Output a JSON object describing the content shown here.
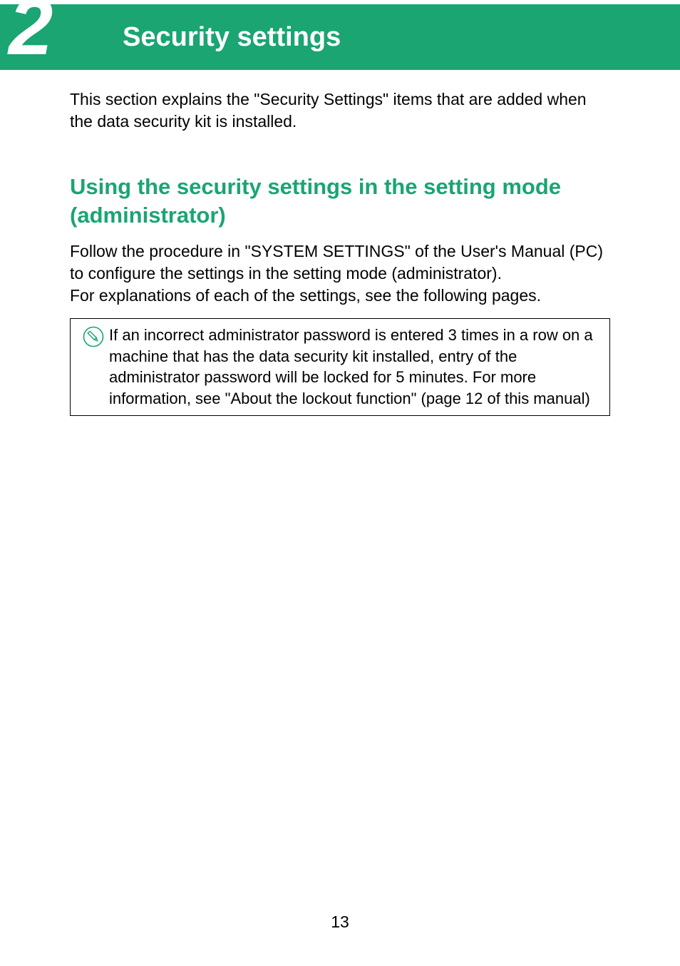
{
  "header": {
    "chapter_number": "2",
    "chapter_title": "Security settings"
  },
  "intro": "This section explains the \"Security Settings\" items that are added when the data security kit is installed.",
  "section": {
    "heading": "Using the security settings in the setting mode (administrator)",
    "body": "Follow the procedure in \"SYSTEM SETTINGS\" of the User's Manual (PC) to configure the settings in the setting mode (administrator).\nFor explanations of each of the settings, see the following pages."
  },
  "note": {
    "icon_name": "pencil-circle-icon",
    "text": "If an incorrect administrator password is entered 3 times in a row on a machine that has the data security kit installed, entry of the administrator password will be locked for 5 minutes. For more information, see \"About the lockout function\" (page 12 of this manual)"
  },
  "page_number": "13",
  "colors": {
    "brand_green": "#1aa573"
  }
}
